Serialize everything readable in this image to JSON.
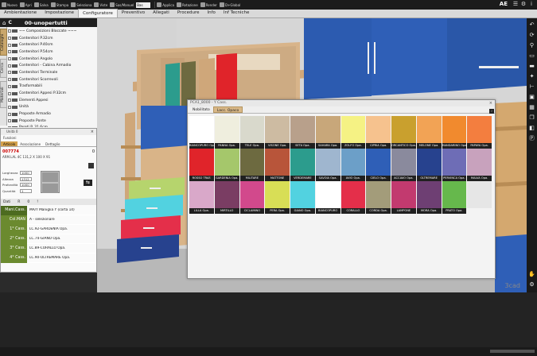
{
  "toolbar": {
    "items": [
      {
        "label": "Nuovo",
        "icon": "new-file-icon"
      },
      {
        "label": "Apri",
        "icon": "open-folder-icon"
      },
      {
        "label": "Salva",
        "icon": "save-icon"
      },
      {
        "label": "Stampa",
        "icon": "print-icon"
      },
      {
        "label": "Seleziona",
        "icon": "cursor-icon"
      },
      {
        "label": "Viste",
        "icon": "camera-icon"
      },
      {
        "label": "Sas/Manuel",
        "icon": "sync-icon"
      }
    ],
    "combo_value": "Bas",
    "right_items": [
      {
        "label": "Applica",
        "icon": "check-icon"
      },
      {
        "label": "Rotazione",
        "icon": "rotate-icon"
      },
      {
        "label": "Render",
        "icon": "render-icon"
      },
      {
        "label": "D+Global",
        "icon": "globe-icon"
      }
    ],
    "logo": "AE"
  },
  "menu": {
    "tabs": [
      "Ambientazione",
      "Impostazione",
      "Configuratore",
      "Preventivo",
      "Allegati",
      "Procedure",
      "Info",
      "Inf Tecniche"
    ],
    "active": 2
  },
  "tree": {
    "code": "C",
    "title": "00-unopertutti",
    "vtabs": [
      "Cataloghi",
      "Cerca",
      "Materiali"
    ],
    "items": [
      "~~ Composizioni Bloccate ~~~",
      "Contenitori P.32cm",
      "Contenitori P.40cm",
      "Contenitori P.54cm",
      "Contenitori Angolo",
      "Contenitori - Cabina Armadio",
      "Contenitori Terminale",
      "Contenitori Scorrevoli",
      "Trasformabili",
      "Contenitori Appesi P.32cm",
      "Elementi Appesi",
      "Unità",
      "Proposte Armadio",
      "Proposte Ponte",
      "Pareti P. 31,6cm"
    ]
  },
  "properties": {
    "title": "Unità 0",
    "subtitle": "Funzioni",
    "tabs": [
      "Articolo",
      "Associazione",
      "Dettaglio"
    ],
    "active_tab": 0,
    "code": "007774",
    "description": "ARM.LAL 4C   131,2 X 100 X 91",
    "quantity": "0",
    "dims": [
      {
        "label": "Larghezza",
        "value": "1000"
      },
      {
        "label": "Altezza",
        "value": "1312"
      },
      {
        "label": "Profondità",
        "value": "1000"
      },
      {
        "label": "Quantità",
        "value": "1"
      }
    ],
    "grid_head": [
      "Dati",
      "R",
      "0",
      "!"
    ],
    "rows": [
      {
        "key": "Mani.Cass.",
        "value": "MA/Y Maniglia Y (corta 14)"
      },
      {
        "key": "Col.MAN",
        "value": "A - selezionare"
      },
      {
        "key": "1° Cass.",
        "value": "LC.92-GARDENIA Opa."
      },
      {
        "key": "2° Cass.",
        "value": "LC.74-GIANO Opa."
      },
      {
        "key": "3° Cass.",
        "value": "LC.89-CORALLO Opa."
      },
      {
        "key": "4° Cass.",
        "value": "LC.90-OLTREMARE Opa."
      }
    ]
  },
  "palette": {
    "title": "PCA1_8000 - Y Cass.",
    "tabs": [
      "Nobilitato",
      "Lacc. Opaco"
    ],
    "active_tab": 1,
    "swatches": [
      {
        "name": "BIANCOPURO Opa.",
        "color": "#ffffff"
      },
      {
        "name": "PANNA Opa.",
        "color": "#efeede"
      },
      {
        "name": "TELE Opa.",
        "color": "#d9d9cc"
      },
      {
        "name": "VISONE Opa.",
        "color": "#cdbba2"
      },
      {
        "name": "SETA Opa.",
        "color": "#b8a08b"
      },
      {
        "name": "SAHARA Opa.",
        "color": "#c8a77a"
      },
      {
        "name": "ZOLFO Opa.",
        "color": "#f5f284"
      },
      {
        "name": "CIPRIA Opa.",
        "color": "#f6c28e"
      },
      {
        "name": "ORCANTICO Opa.",
        "color": "#c9a02e"
      },
      {
        "name": "MELONE Opa.",
        "color": "#f2a355"
      },
      {
        "name": "MANDARINO Opa.",
        "color": "#f18a2e"
      },
      {
        "name": "PAPAYA Opa.",
        "color": "#f37e3f"
      },
      {
        "name": "ROSSO TRAF.",
        "color": "#e0242a"
      },
      {
        "name": "GARDENIA Opa.",
        "color": "#a5c76b"
      },
      {
        "name": "MILITARE",
        "color": "#6d6a40"
      },
      {
        "name": "MATTONE",
        "color": "#b8553a"
      },
      {
        "name": "VERDEMARE",
        "color": "#2c9c8d"
      },
      {
        "name": "SAVOIA Opa.",
        "color": "#9fb6cf"
      },
      {
        "name": "AVIO Opa.",
        "color": "#6c9fc8"
      },
      {
        "name": "CIELO Opa.",
        "color": "#2f5fb7"
      },
      {
        "name": "ACCIAIO Opa.",
        "color": "#8a8a9d"
      },
      {
        "name": "OLTREMARE",
        "color": "#27428e"
      },
      {
        "name": "PERVINCA Opa.",
        "color": "#6e6db6"
      },
      {
        "name": "MALVA Opa.",
        "color": "#c8a2bd"
      },
      {
        "name": "LILLA Opa.",
        "color": "#d9a8c9"
      },
      {
        "name": "MIRTILLO",
        "color": "#7a3d63"
      },
      {
        "name": "CICLAMINO",
        "color": "#d2498c"
      },
      {
        "name": "PERA Opa.",
        "color": "#d8de56"
      },
      {
        "name": "GIANO Opa.",
        "color": "#52d2e0"
      },
      {
        "name": "BIANCOPURO",
        "color": "#ffffff"
      },
      {
        "name": "CORALLO",
        "color": "#e42f4a"
      },
      {
        "name": "CORDA Opa.",
        "color": "#a39c7a"
      },
      {
        "name": "LAMPONE",
        "color": "#c23a6f"
      },
      {
        "name": "MORA Opa.",
        "color": "#6e3f73"
      },
      {
        "name": "PRATO Opa.",
        "color": "#66b84c"
      },
      {
        "name": "",
        "color": "#e6e6e6"
      }
    ]
  },
  "viewport": {
    "logo": "3cad"
  },
  "colors": {
    "accent": "#d4a24c",
    "grid_key": "#6b8a2f",
    "toolbar_bg": "#1c1c1c"
  }
}
